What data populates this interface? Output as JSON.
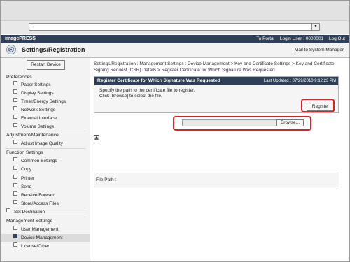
{
  "topbar": {
    "brand": "imagePRESS",
    "to_portal": "To Portal",
    "login_user": "Login User : 0000001",
    "logout": "Log Out"
  },
  "header": {
    "title": "Settings/Registration",
    "mail_link": "Mail to System Manager",
    "icon": "gear-icon"
  },
  "sidebar": {
    "restart_label": "Restart Device",
    "sections": {
      "preferences": "Preferences",
      "adjust": "Adjustment/Maintenance",
      "function": "Function Settings",
      "management": "Management Settings"
    },
    "items": {
      "paper": "Paper Settings",
      "display": "Display Settings",
      "timer": "Timer/Energy Settings",
      "network": "Network Settings",
      "external": "External Interface",
      "volume": "Volume Settings",
      "image_quality": "Adjust Image Quality",
      "common": "Common Settings",
      "copy": "Copy",
      "printer": "Printer",
      "send": "Send",
      "receive": "Receive/Forward",
      "store": "Store/Access Files",
      "set_destination": "Set Destination",
      "user_mgmt": "User Management",
      "device_mgmt": "Device Management",
      "license": "License/Other"
    }
  },
  "main": {
    "breadcrumb_line1": "Settings/Registration : Management Settings : Device Management > Key and Certificate Settings > Key and Certificate",
    "breadcrumb_line2": "Signing Request (CSR) Details > Register Certificate for Which Signature Was Requested",
    "panel_title": "Register Certificate for Which Signature Was Requested",
    "last_updated": "Last Updated : 07/29/2010 9:12:23 PM",
    "instruction1": "Specify the path to the certificate file to register.",
    "instruction2": "Click [Browse] to select the file.",
    "register_label": "Register",
    "file_path_label": "File Path :",
    "file_path_value": "",
    "browse_label": "Browse...",
    "scroll_top_icon": "arrow-up-icon"
  },
  "colors": {
    "header_bar": "#2f3f57",
    "highlight_ring": "#d8232a"
  }
}
